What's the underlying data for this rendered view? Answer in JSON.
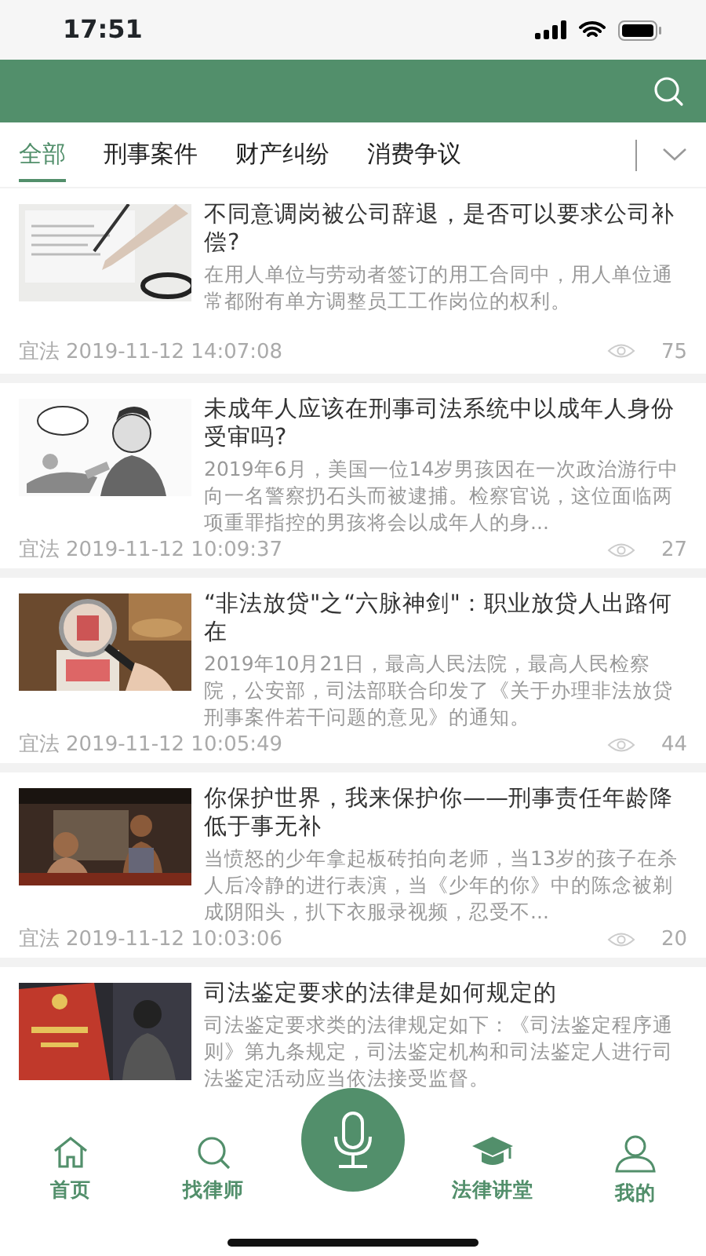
{
  "status_bar": {
    "time": "17:51"
  },
  "category_tabs": [
    {
      "label": "全部",
      "selected": true
    },
    {
      "label": "刑事案件",
      "selected": false
    },
    {
      "label": "财产纠纷",
      "selected": false
    },
    {
      "label": "消费争议",
      "selected": false
    }
  ],
  "articles": [
    {
      "title": "不同意调岗被公司辞退，是否可以要求公司补偿?",
      "summary": "在用人单位与劳动者签订的用工合同中，用人单位通常都附有单方调整员工工作岗位的权利。",
      "source": "宜法",
      "time": "2019-11-12 14:07:08",
      "views": "75"
    },
    {
      "title": "未成年人应该在刑事司法系统中以成年人身份受审吗?",
      "summary": "2019年6月，美国一位14岁男孩因在一次政治游行中向一名警察扔石头而被逮捕。检察官说，这位面临两项重罪指控的男孩将会以成年人的身...",
      "source": "宜法",
      "time": "2019-11-12 10:09:37",
      "views": "27"
    },
    {
      "title": "“非法放贷\"之“六脉神剑\"：职业放贷人出路何在",
      "summary": "2019年10月21日，最高人民法院，最高人民检察院，公安部，司法部联合印发了《关于办理非法放贷刑事案件若干问题的意见》的通知。",
      "source": "宜法",
      "time": "2019-11-12 10:05:49",
      "views": "44"
    },
    {
      "title": "你保护世界，我来保护你——刑事责任年龄降低于事无补",
      "summary": "当愤怒的少年拿起板砖拍向老师，当13岁的孩子在杀人后冷静的进行表演，当《少年的你》中的陈念被剃成阴阳头，扒下衣服录视频，忍受不...",
      "source": "宜法",
      "time": "2019-11-12 10:03:06",
      "views": "20"
    },
    {
      "title": "司法鉴定要求的法律是如何规定的",
      "summary": "司法鉴定要求类的法律规定如下：《司法鉴定程序通则》第九条规定，司法鉴定机构和司法鉴定人进行司法鉴定活动应当依法接受监督。"
    }
  ],
  "bottom_nav": [
    {
      "kind": "home",
      "label": "首页"
    },
    {
      "kind": "search",
      "label": "找律师"
    },
    {
      "kind": "mic"
    },
    {
      "kind": "cap",
      "label": "法律讲堂"
    },
    {
      "kind": "user",
      "label": "我的"
    }
  ]
}
